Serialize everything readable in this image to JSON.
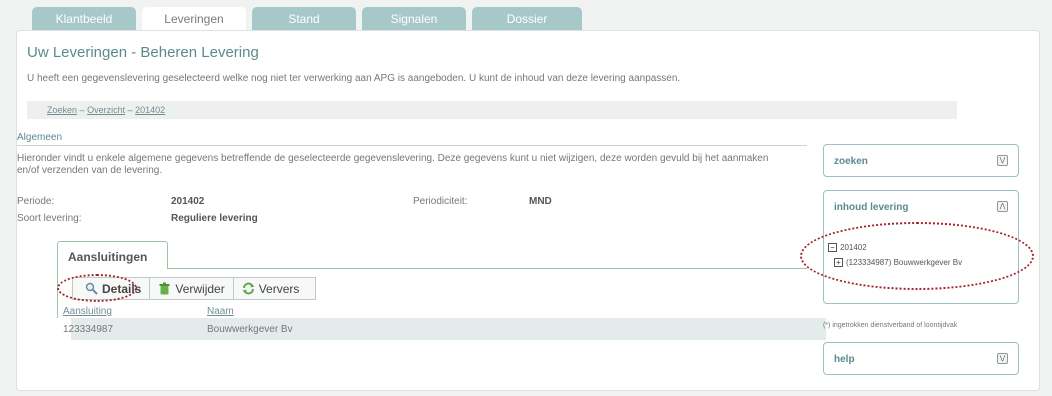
{
  "tabs": [
    {
      "label": "Klantbeeld",
      "active": false
    },
    {
      "label": "Leveringen",
      "active": true
    },
    {
      "label": "Stand",
      "active": false
    },
    {
      "label": "Signalen",
      "active": false
    },
    {
      "label": "Dossier",
      "active": false
    }
  ],
  "page": {
    "title": "Uw Leveringen - Beheren Levering",
    "intro": "U heeft een gegevenslevering geselecteerd welke nog niet ter verwerking aan APG is aangeboden. U kunt de inhoud van deze levering aanpassen."
  },
  "breadcrumb": {
    "items": [
      "Zoeken",
      "Overzicht",
      "201402"
    ],
    "separator": "–"
  },
  "algemeen": {
    "title": "Algemeen",
    "description": "Hieronder vindt u enkele algemene gegevens betreffende de geselecteerde gegevenslevering. Deze gegevens kunt u niet wijzigen, deze worden gevuld bij het aanmaken en/of verzenden van de levering.",
    "periode_label": "Periode:",
    "periode_value": "201402",
    "soort_label": "Soort levering:",
    "soort_value": "Reguliere levering",
    "periodiciteit_label": "Periodiciteit:",
    "periodiciteit_value": "MND"
  },
  "aansluitingen": {
    "tab_label": "Aansluitingen",
    "toolbar": {
      "details": "Details",
      "verwijder": "Verwijder",
      "ververs": "Ververs"
    },
    "columns": [
      "Aansluiting",
      "Naam"
    ],
    "rows": [
      {
        "aansluiting": "123334987",
        "naam": "Bouwwerkgever Bv"
      }
    ]
  },
  "sidebar": {
    "zoeken": "zoeken",
    "inhoud": "inhoud levering",
    "tree_root": "201402",
    "tree_child": "(123334987) Bouwwerkgever Bv",
    "note": "(*) ingetrokken dienstverband of loontijdvak",
    "help": "help"
  },
  "colors": {
    "accent": "#5b8a8d",
    "tab_inactive": "#a6c8c9",
    "annotation": "#a3242c"
  }
}
